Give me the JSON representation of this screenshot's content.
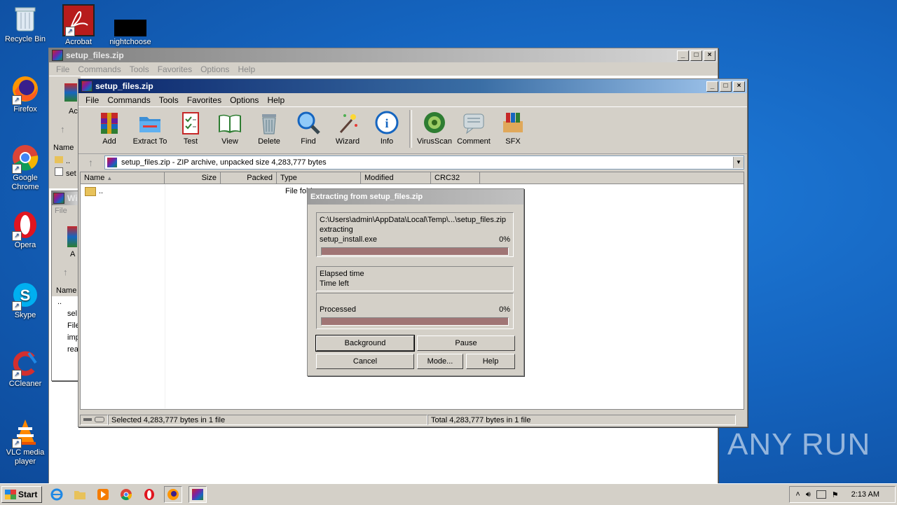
{
  "desktop_icons": [
    {
      "name": "recycle-bin-icon",
      "label": "Recycle Bin"
    },
    {
      "name": "acrobat-icon",
      "label": "Acrobat"
    },
    {
      "name": "nightchoose-icon",
      "label": "nightchoose"
    },
    {
      "name": "firefox-icon",
      "label": "Firefox"
    },
    {
      "name": "chrome-icon",
      "label": "Google Chrome"
    },
    {
      "name": "opera-icon",
      "label": "Opera"
    },
    {
      "name": "skype-icon",
      "label": "Skype"
    },
    {
      "name": "ccleaner-icon",
      "label": "CCleaner"
    },
    {
      "name": "vlc-icon",
      "label": "VLC media player"
    }
  ],
  "back_window": {
    "title": "setup_files.zip",
    "menu": [
      "File",
      "Commands",
      "Tools",
      "Favorites",
      "Options",
      "Help"
    ],
    "name_col": "Name",
    "partial_labels": {
      "add": "Ac",
      "rows": [
        "..",
        "set"
      ]
    }
  },
  "back_window2": {
    "title": "Wi",
    "menu": [
      "File"
    ],
    "name_col": "Name",
    "partial_labels": {
      "add": "A",
      "rows": [
        "..",
        "sel",
        "File",
        "imp",
        "rea"
      ]
    }
  },
  "main_window": {
    "title": "setup_files.zip",
    "menu": [
      "File",
      "Commands",
      "Tools",
      "Favorites",
      "Options",
      "Help"
    ],
    "toolbar": [
      {
        "icon": "add-icon",
        "label": "Add"
      },
      {
        "icon": "extract-to-icon",
        "label": "Extract To"
      },
      {
        "icon": "test-icon",
        "label": "Test"
      },
      {
        "icon": "view-icon",
        "label": "View"
      },
      {
        "icon": "delete-icon",
        "label": "Delete"
      },
      {
        "icon": "find-icon",
        "label": "Find"
      },
      {
        "icon": "wizard-icon",
        "label": "Wizard"
      },
      {
        "icon": "info-icon",
        "label": "Info"
      },
      {
        "icon": "virusscan-icon",
        "label": "VirusScan"
      },
      {
        "icon": "comment-icon",
        "label": "Comment"
      },
      {
        "icon": "sfx-icon",
        "label": "SFX"
      }
    ],
    "address": "setup_files.zip - ZIP archive, unpacked size 4,283,777 bytes",
    "columns": [
      "Name",
      "Size",
      "Packed",
      "Type",
      "Modified",
      "CRC32"
    ],
    "rows": [
      {
        "name": "..",
        "type": "File fold"
      }
    ],
    "status_left": "Selected 4,283,777 bytes in 1 file",
    "status_right": "Total 4,283,777 bytes in 1 file"
  },
  "dialog": {
    "title": "Extracting from setup_files.zip",
    "path": "C:\\Users\\admin\\AppData\\Local\\Temp\\...\\setup_files.zip",
    "action": "extracting",
    "file": "setup_install.exe",
    "file_percent": "0%",
    "file_progress": 0,
    "elapsed_label": "Elapsed time",
    "left_label": "Time left",
    "processed_label": "Processed",
    "processed_percent": "0%",
    "processed_progress": 0,
    "buttons": {
      "background": "Background",
      "pause": "Pause",
      "cancel": "Cancel",
      "mode": "Mode...",
      "help": "Help"
    }
  },
  "taskbar": {
    "start": "Start",
    "clock": "2:13 AM",
    "apps": [
      "ie-icon",
      "explorer-icon",
      "media-player-icon",
      "chrome-taskbar-icon",
      "opera-taskbar-icon",
      "firefox-taskbar-icon",
      "winrar-taskbar-icon"
    ]
  },
  "watermark": "ANY RUN"
}
